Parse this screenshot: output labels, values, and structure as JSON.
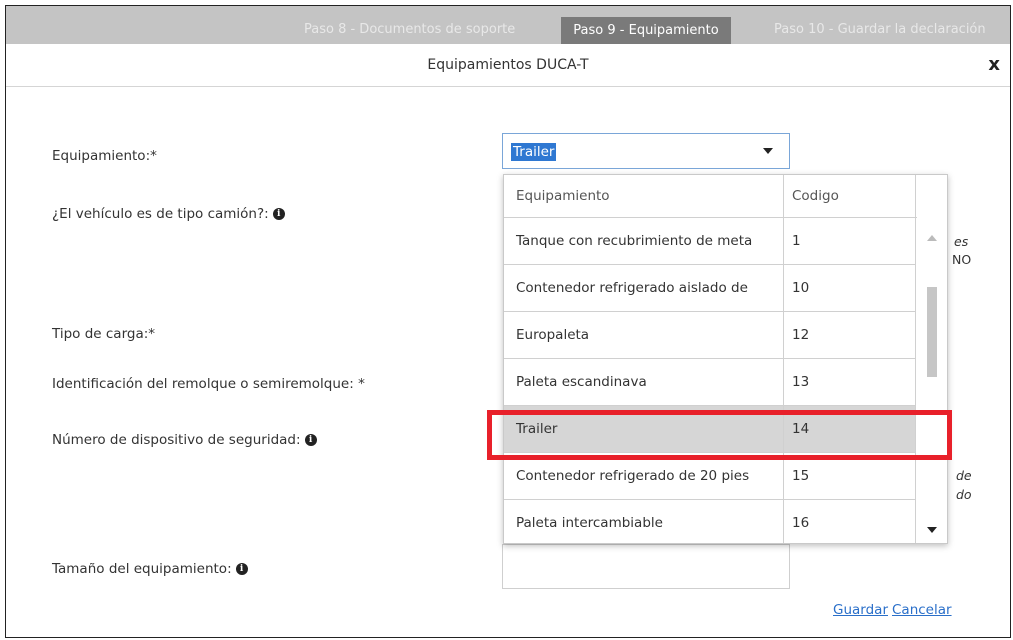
{
  "tabs": {
    "step8": "Paso 8 - Documentos de soporte",
    "step9": "Paso 9 - Equipamiento",
    "step10": "Paso 10 - Guardar la declaración"
  },
  "modal": {
    "title": "Equipamientos DUCA-T",
    "close_label": "x"
  },
  "form": {
    "equipment_label": "Equipamiento:*",
    "truck_label": "¿El vehículo es de tipo camión?:",
    "cargo_label": "Tipo de carga:*",
    "trailer_id_label": "Identificación del remolque o semiremolque: *",
    "security_label": "Número de dispositivo de seguridad:",
    "size_label": "Tamaño del equipamiento:",
    "info_glyph": "i",
    "selected_equipment": "Trailer",
    "peek_1a": "es",
    "peek_1b": "NO",
    "peek_2a": "de",
    "peek_2b": "do"
  },
  "dropdown": {
    "columns": [
      "Equipamiento",
      "Codigo"
    ],
    "rows": [
      {
        "name": "Tanque con recubrimiento de meta",
        "code": "1"
      },
      {
        "name": "Contenedor refrigerado aislado de",
        "code": "10"
      },
      {
        "name": "Europaleta",
        "code": "12"
      },
      {
        "name": "Paleta escandinava",
        "code": "13"
      },
      {
        "name": "Trailer",
        "code": "14"
      },
      {
        "name": "Contenedor refrigerado de 20 pies",
        "code": "15"
      },
      {
        "name": "Paleta intercambiable",
        "code": "16"
      }
    ],
    "selected_row": 4
  },
  "actions": {
    "save": "Guardar",
    "cancel": "Cancelar"
  },
  "colors": {
    "highlight": "#e8202a",
    "selection": "#2f78d2",
    "link": "#2a6fc9"
  }
}
